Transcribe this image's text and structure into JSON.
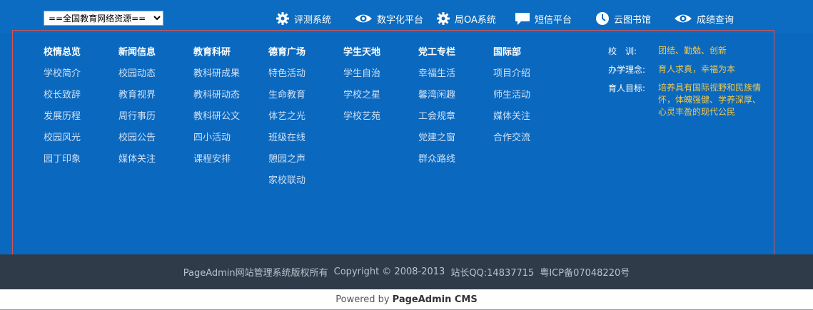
{
  "top": {
    "select_value": "==全国教育网络资源==",
    "links": [
      {
        "label": "评测系统",
        "icon": "gear-icon"
      },
      {
        "label": "数字化平台",
        "icon": "eye-icon"
      },
      {
        "label": "局OA系统",
        "icon": "gear-icon"
      },
      {
        "label": "短信平台",
        "icon": "chat-icon"
      },
      {
        "label": "云图书馆",
        "icon": "clock-icon"
      },
      {
        "label": "成绩查询",
        "icon": "eye-icon"
      }
    ]
  },
  "nav": [
    {
      "title": "校情总览",
      "items": [
        "学校简介",
        "校长致辞",
        "发展历程",
        "校园风光",
        "园丁印象"
      ]
    },
    {
      "title": "新闻信息",
      "items": [
        "校园动态",
        "教育视界",
        "周行事历",
        "校园公告",
        "媒体关注"
      ]
    },
    {
      "title": "教育科研",
      "items": [
        "教科研成果",
        "教科研动态",
        "教科研公文",
        "四小活动",
        "课程安排"
      ]
    },
    {
      "title": "德育广场",
      "items": [
        "特色活动",
        "生命教育",
        "体艺之光",
        "班级在线",
        "憩园之声",
        "家校联动"
      ]
    },
    {
      "title": "学生天地",
      "items": [
        "学生自治",
        "学校之星",
        "学校艺苑"
      ]
    },
    {
      "title": "党工专栏",
      "items": [
        "幸福生活",
        "馨湾闲趣",
        "工会规章",
        "党建之窗",
        "群众路线"
      ]
    },
    {
      "title": "国际部",
      "items": [
        "项目介绍",
        "师生活动",
        "媒体关注",
        "合作交流"
      ]
    }
  ],
  "motto": {
    "school_motto_label": "校　训:",
    "school_motto": "团结、勤勉、创新",
    "philosophy_label": "办学理念:",
    "philosophy": "育人求真，幸福为本",
    "goal_label": "育人目标:",
    "goal": "培养具有国际视野和民族情怀，体魄强健、学养深厚、心灵丰盈的现代公民"
  },
  "footer": {
    "owner": "PageAdmin网站管理系统版权所有",
    "copyright": "Copyright © 2008-2013",
    "qq": "站长QQ:14837715",
    "icp": "粤ICP备07048220号",
    "powered_prefix": "Powered by",
    "powered_brand": "PageAdmin CMS"
  },
  "colors": {
    "top_bar": "#0b6cc1",
    "main_bg": "#0a68bf",
    "motto_accent": "#f2c94c",
    "footer_bg": "#2f3b48"
  }
}
